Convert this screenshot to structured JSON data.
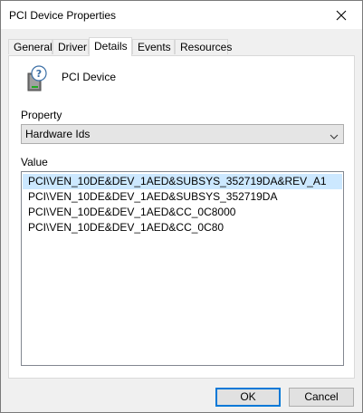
{
  "window": {
    "title": "PCI Device Properties"
  },
  "tabs": [
    {
      "label": "General"
    },
    {
      "label": "Driver"
    },
    {
      "label": "Details",
      "active": true
    },
    {
      "label": "Events"
    },
    {
      "label": "Resources"
    }
  ],
  "device": {
    "name": "PCI Device",
    "icon": "device-question-icon"
  },
  "property": {
    "label": "Property",
    "selected": "Hardware Ids"
  },
  "value": {
    "label": "Value",
    "items": [
      "PCI\\VEN_10DE&DEV_1AED&SUBSYS_352719DA&REV_A1",
      "PCI\\VEN_10DE&DEV_1AED&SUBSYS_352719DA",
      "PCI\\VEN_10DE&DEV_1AED&CC_0C8000",
      "PCI\\VEN_10DE&DEV_1AED&CC_0C80"
    ],
    "selected_index": 0
  },
  "buttons": {
    "ok": "OK",
    "cancel": "Cancel"
  },
  "colors": {
    "selection": "#cce8ff",
    "accent": "#0078d7"
  }
}
